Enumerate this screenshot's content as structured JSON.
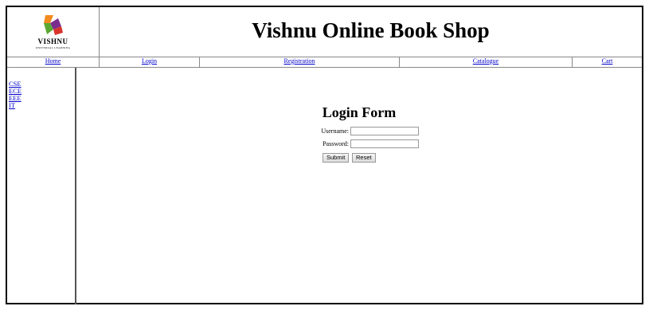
{
  "site": {
    "title": "Vishnu Online Book Shop",
    "logo_text": "VISHNU",
    "logo_subtext": "UNIVERSAL LEARNING"
  },
  "nav": {
    "items": [
      {
        "label": "Home"
      },
      {
        "label": "Login"
      },
      {
        "label": "Registration"
      },
      {
        "label": "Catalogue"
      },
      {
        "label": "Cart"
      }
    ]
  },
  "sidebar": {
    "items": [
      {
        "label": "CSE"
      },
      {
        "label": "ECE"
      },
      {
        "label": "EEE"
      },
      {
        "label": "IT"
      }
    ]
  },
  "form": {
    "title": "Login Form",
    "username_label": "Username:",
    "username_value": "",
    "password_label": "Password:",
    "password_value": "",
    "submit_label": "Submit",
    "reset_label": "Reset"
  },
  "colors": {
    "link": "#0000cc",
    "logo_orange": "#f28c1e",
    "logo_purple": "#7b2d8e",
    "logo_green": "#5aa832",
    "logo_red": "#d8342b"
  }
}
